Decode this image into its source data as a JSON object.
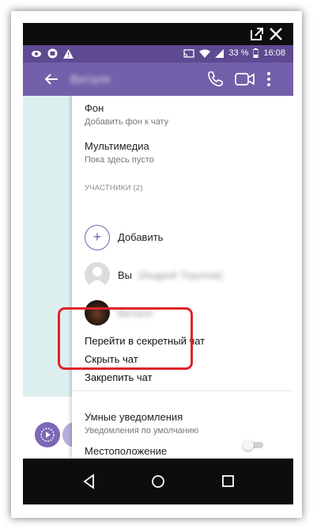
{
  "status": {
    "battery": "33 %",
    "time": "16:08",
    "icons": [
      "eye-icon",
      "screen-icon",
      "warning-icon",
      "cast-icon",
      "wifi-icon",
      "signal-icon",
      "battery-icon"
    ]
  },
  "appbar": {
    "title": "Виталя",
    "icons": [
      "back-arrow-icon",
      "phone-icon",
      "video-icon",
      "more-vert-icon"
    ],
    "color": "#7360aa"
  },
  "sections": {
    "background": {
      "title": "Фон",
      "subtitle": "Добавить фон к чату"
    },
    "media": {
      "title": "Мультимедиа",
      "subtitle": "Пока здесь пусто"
    },
    "participants": {
      "header": "УЧАСТНИКИ (2)",
      "add_label": "Добавить",
      "members": [
        {
          "name": "Вы",
          "detail": "(Андрей Торопов)"
        },
        {
          "name": "Виталя"
        }
      ]
    },
    "actions": {
      "secret_chat": "Перейти в секретный чат",
      "hide_chat": "Скрыть чат",
      "pin_chat": "Закрепить чат"
    },
    "notifications": {
      "title": "Умные уведомления",
      "subtitle": "Уведомления по умолчанию",
      "enabled": false
    },
    "location": {
      "title": "Местоположение"
    }
  },
  "colors": {
    "highlight": "#e0222a",
    "status_bar": "#5d4a90"
  }
}
